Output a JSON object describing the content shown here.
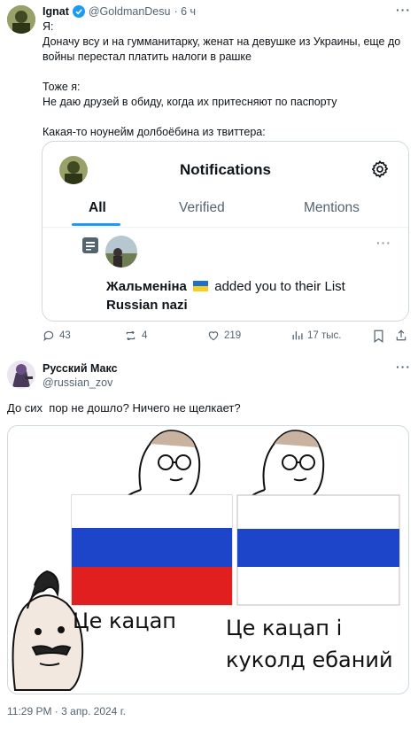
{
  "colors": {
    "accent": "#1d9bf0",
    "muted": "#536471",
    "border": "#cfd9de"
  },
  "tweet": {
    "author_name": "Ignat",
    "handle": "@GoldmanDesu",
    "time": "· 6 ч",
    "lines": [
      "Я:",
      "Доначу всу и на гумманитарку, женат на девушке из Украины, еще до",
      "войны перестал платить налоги в рашке",
      "Тоже я:",
      "Не даю друзей в обиду, когда их притесняют по паспорту",
      "Какая-то ноунейм долбоёбина из твиттера:"
    ],
    "embedded": {
      "header_title": "Notifications",
      "tabs": [
        "All",
        "Verified",
        "Mentions"
      ],
      "active_tab": "All",
      "notif_name": "Жальменіна",
      "flag_icon": "ukraine-flag",
      "notif_text": "added you to their List",
      "list_name": "Russian nazi"
    },
    "actions": {
      "replies": "43",
      "retweets": "4",
      "likes": "219",
      "views": "17 тыс."
    }
  },
  "reply": {
    "author_name": "Русский Макс",
    "handle": "@russian_zov",
    "text": "До сих  пор не дошло? Ничего не щелкает?",
    "meme": {
      "left_caption": "Це кацап",
      "right_caption_line1": "Це кацап і",
      "right_caption_line2": "куколд ебаний"
    },
    "timestamp": "11:29 PM · 3 апр. 2024 г."
  }
}
